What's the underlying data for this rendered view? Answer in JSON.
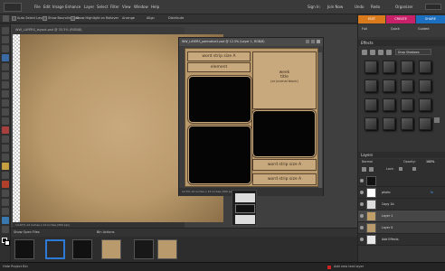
{
  "menu": [
    "File",
    "Edit",
    "Image",
    "Enhance",
    "Layer",
    "Select",
    "Filter",
    "View",
    "Window",
    "Help"
  ],
  "topright": {
    "signin": "Sign In",
    "join": "Join Now",
    "undo": "Undo",
    "redo": "Redo",
    "organizer": "Organizer"
  },
  "options": {
    "auto_select": "Auto Select Layer",
    "bounding": "Show Bounding Box",
    "highlight": "Show Highlight on Rollover",
    "arrange": "Arrange",
    "align": "Align",
    "distribute": "Distribute"
  },
  "doc1": {
    "tab": "WW_LAYERS_layout.psd @ 33.3% (RGB/8)",
    "status": "14.67%  12 inches x 12 inches (300 ppi)"
  },
  "doc2": {
    "title": "WW_LAYERS_palmolive2.psd @ 12.5% (Layer 1, RGB/8)",
    "status": "12.5%   12 inches x 12 inches (300 ppi)",
    "cells": {
      "strip_a_top": "word strip size A",
      "element": "element",
      "week_title": "week",
      "week_title2": "title",
      "journal": "(or journal block)",
      "strip_b1": "word strip size A",
      "strip_b2": "word strip size A"
    }
  },
  "bins": {
    "show_open": "Show Open Files",
    "bin_actions": "Bin Actions",
    "hide_bin": "Hide Project Bin",
    "add_text": "Add new text layer"
  },
  "modes": {
    "edit": "EDIT",
    "create": "CREATE",
    "share": "SHARE"
  },
  "actions": [
    "Full",
    "Quick",
    "Guided"
  ],
  "effects": {
    "header": "Effects",
    "dropdown": "Drop Shadows"
  },
  "layers": {
    "header": "Layers",
    "normal": "Normal",
    "opacity": "Opacity:",
    "opacity_val": "100%",
    "lock": "Lock:",
    "items": [
      "",
      "photo",
      "Copy 1b",
      "Layer 1",
      "Layer 0",
      "Add Effects"
    ]
  },
  "colors": {
    "accent_edit": "#d97a1c",
    "accent_create": "#c9206a",
    "accent_share": "#1d6fc0",
    "paper": "#b99a6c"
  }
}
